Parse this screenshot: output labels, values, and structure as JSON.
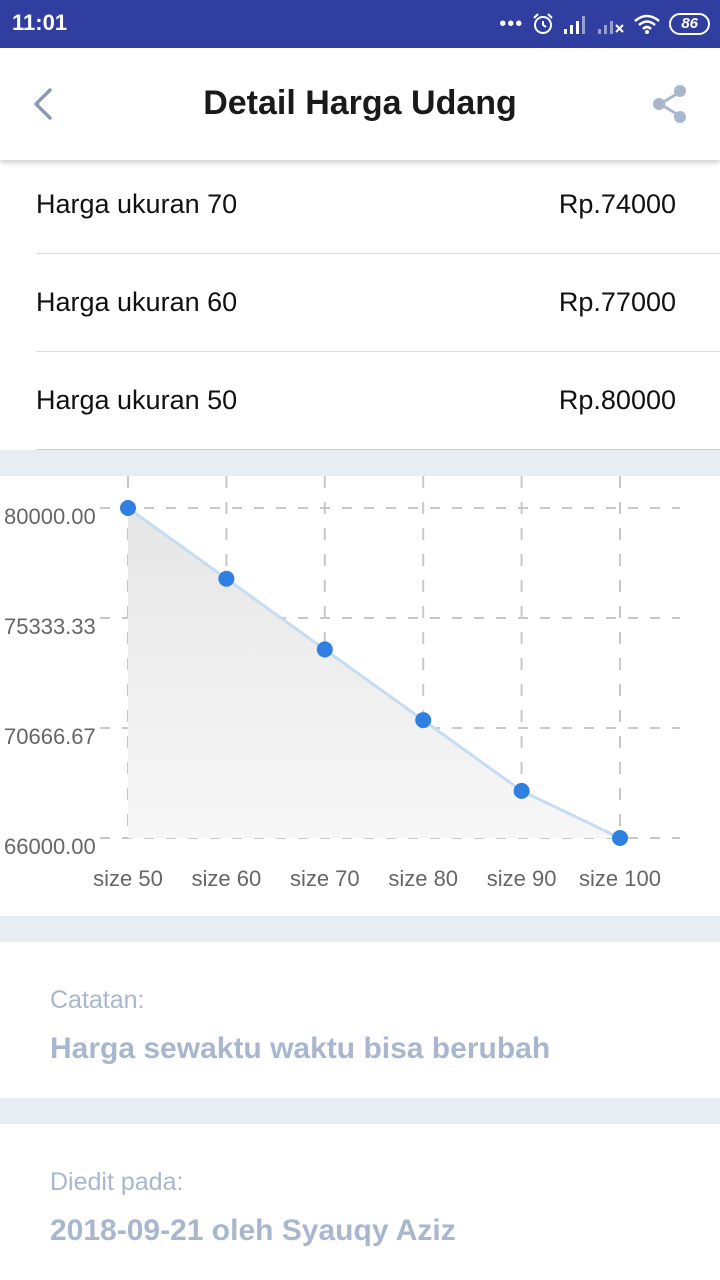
{
  "status_bar": {
    "time": "11:01",
    "battery": "86",
    "icons": [
      "more-dots-icon",
      "alarm-icon",
      "signal-icon",
      "signal-no-sim-icon",
      "wifi-icon",
      "battery-icon"
    ]
  },
  "app_bar": {
    "title": "Detail Harga Udang",
    "back_icon": "chevron-left-icon",
    "share_icon": "share-icon"
  },
  "prices": [
    {
      "label": "Harga ukuran 70",
      "value": "Rp.74000"
    },
    {
      "label": "Harga ukuran 60",
      "value": "Rp.77000"
    },
    {
      "label": "Harga ukuran 50",
      "value": "Rp.80000"
    }
  ],
  "chart_data": {
    "type": "area",
    "categories": [
      "size 50",
      "size 60",
      "size 70",
      "size 80",
      "size 90",
      "size 100"
    ],
    "series": [
      {
        "values": [
          80000,
          77000,
          74000,
          71000,
          68000,
          66000
        ]
      }
    ],
    "yticks": [
      "80000.00",
      "75333.33",
      "70666.67",
      "66000.00"
    ],
    "ylim": [
      66000,
      80000
    ],
    "grid": true,
    "colors": {
      "point": "#2f80e0",
      "line": "#c6dcf2",
      "fill_top": "#e6e6e6",
      "fill_bottom": "#f7f7f7",
      "grid": "#c8c8c8"
    }
  },
  "note": {
    "label": "Catatan:",
    "value": "Harga sewaktu waktu bisa berubah"
  },
  "edited": {
    "label": "Diedit pada:",
    "value": "2018-09-21 oleh Syauqy Aziz"
  },
  "colors": {
    "status_bar": "#303f9f",
    "muted_text": "#a9b7ce",
    "section_gap": "#e8edf4"
  }
}
